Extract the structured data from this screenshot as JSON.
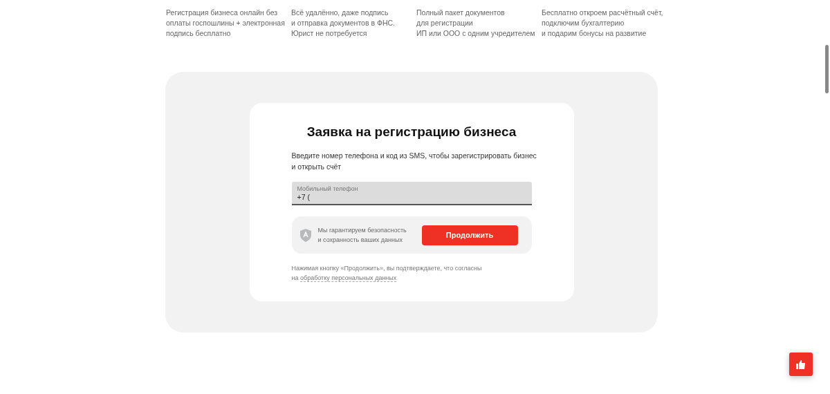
{
  "features": [
    {
      "lines": [
        "Регистрация бизнеса онлайн без",
        "оплаты госпошлины + электронная",
        "подпись бесплатно"
      ]
    },
    {
      "lines": [
        "Всё удалённо, даже подпись",
        "и отправка документов в ФНС.",
        "Юрист не потребуется"
      ]
    },
    {
      "lines": [
        "Полный пакет документов",
        "для регистрации",
        "ИП или ООО с одним учредителем"
      ]
    },
    {
      "lines": [
        "Бесплатно откроем расчётный счёт,",
        "подключим бухгалтерию",
        "и подарим бонусы на развитие"
      ]
    }
  ],
  "form": {
    "title": "Заявка на регистрацию бизнеса",
    "subtitle_lines": [
      "Введите номер телефона и код из SMS, чтобы зарегистрировать бизнес",
      "и открыть счёт"
    ],
    "phone_field": {
      "label": "Мобильный телефон",
      "value": "+7 ("
    },
    "security_lines": [
      "Мы гарантируем безопасность",
      "и сохранность ваших данных"
    ],
    "submit_button": "Продолжить",
    "consent_text": "Нажимая кнопку «Продолжить», вы подтверждаете, что согласны",
    "consent_prefix": "на",
    "consent_link": "обработку персональных данных"
  }
}
